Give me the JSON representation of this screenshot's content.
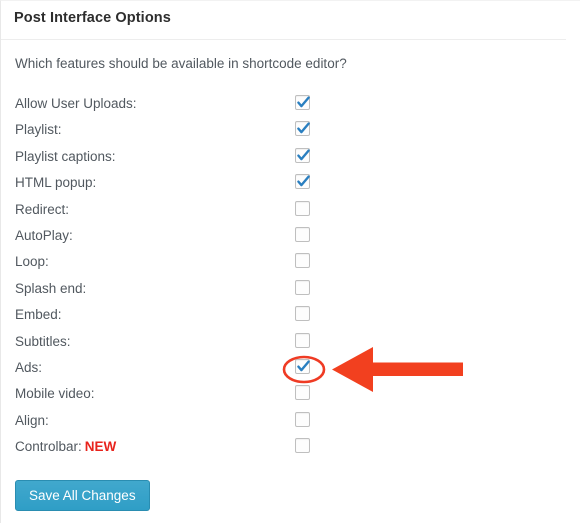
{
  "panel": {
    "title": "Post Interface Options",
    "description": "Which features should be available in shortcode editor?"
  },
  "options": [
    {
      "label": "Allow User Uploads:",
      "checked": true,
      "highlighted": false,
      "badge": ""
    },
    {
      "label": "Playlist:",
      "checked": true,
      "highlighted": false,
      "badge": ""
    },
    {
      "label": "Playlist captions:",
      "checked": true,
      "highlighted": false,
      "badge": ""
    },
    {
      "label": "HTML popup:",
      "checked": true,
      "highlighted": false,
      "badge": ""
    },
    {
      "label": "Redirect:",
      "checked": false,
      "highlighted": false,
      "badge": ""
    },
    {
      "label": "AutoPlay:",
      "checked": false,
      "highlighted": false,
      "badge": ""
    },
    {
      "label": "Loop:",
      "checked": false,
      "highlighted": false,
      "badge": ""
    },
    {
      "label": "Splash end:",
      "checked": false,
      "highlighted": false,
      "badge": ""
    },
    {
      "label": "Embed:",
      "checked": false,
      "highlighted": false,
      "badge": ""
    },
    {
      "label": "Subtitles:",
      "checked": false,
      "highlighted": false,
      "badge": ""
    },
    {
      "label": "Ads:",
      "checked": true,
      "highlighted": true,
      "badge": ""
    },
    {
      "label": "Mobile video:",
      "checked": false,
      "highlighted": false,
      "badge": ""
    },
    {
      "label": "Align:",
      "checked": false,
      "highlighted": false,
      "badge": ""
    },
    {
      "label": "Controlbar:",
      "checked": false,
      "highlighted": false,
      "badge": "NEW"
    }
  ],
  "footer": {
    "save_label": "Save All Changes"
  },
  "annotation": {
    "target_label": "Ads:",
    "ellipse_color": "#ef3b24",
    "arrow_color": "#f2401f",
    "arrow_direction": "left"
  },
  "colors": {
    "checkmark": "#2a7fc0",
    "badge_red": "#e8231c",
    "button_blue": "#2f9ec6",
    "label_text": "#51585f",
    "title_text": "#2d2d2d"
  }
}
